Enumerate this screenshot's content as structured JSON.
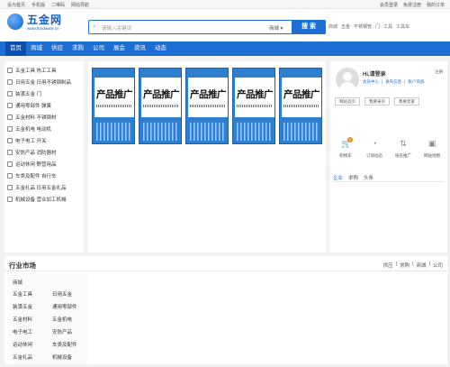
{
  "topbar": {
    "left": [
      "设为首页",
      "手机版",
      "二维码",
      "网站导航"
    ],
    "right": [
      "会员登录",
      "免费注册",
      "我的订单"
    ]
  },
  "logo": {
    "name": "五金网",
    "url": "www.hardware.cn"
  },
  "search": {
    "placeholder": "请输入关键词",
    "scope": "商城",
    "button": "搜 索"
  },
  "hotlinks": [
    "商城",
    "五金",
    "不锈钢管",
    "门",
    "工具",
    "工具车"
  ],
  "nav": [
    "首页",
    "商城",
    "供应",
    "求购",
    "公司",
    "展会",
    "资讯",
    "动态"
  ],
  "categories": [
    "五金工具 热工工具",
    "日用五金 日用不锈钢制品",
    "装潢五金 门",
    "通用零部件 弹簧",
    "五金材料 不锈钢材",
    "五金机电 电动机",
    "电子电工 开关",
    "安防产品 消防器材",
    "运动休闲 野营用品",
    "车类及配件 自行车",
    "五金礼品 日用五金礼品",
    "机械设备 营业加工机械"
  ],
  "promo": {
    "title": "产品推广",
    "count": 5
  },
  "user": {
    "greeting": "Hi,请登录",
    "register": "注册",
    "links": [
      "会员中心",
      "发布信息",
      "账户充值"
    ],
    "buttons": [
      "网站首页",
      "我要采买",
      "我要卖家"
    ],
    "quick": [
      {
        "label": "购物车",
        "icon": "cart-icon",
        "badge": "0"
      },
      {
        "label": "订阅动态",
        "icon": "feed-icon"
      },
      {
        "label": "排名推广",
        "icon": "rank-icon"
      },
      {
        "label": "网站地图",
        "icon": "map-icon"
      }
    ],
    "tabs": [
      "企业",
      "求购",
      "头条"
    ]
  },
  "market": {
    "title": "行业市场",
    "tabs": [
      "供应",
      "|",
      "求购",
      "|",
      "商城",
      "|",
      "公司"
    ],
    "heading": "商城",
    "items": [
      "五金工具",
      "日用五金",
      "装潢五金",
      "通用零部件",
      "五金材料",
      "五金机电",
      "电子电工",
      "安防产品",
      "运动休闲",
      "车类及配件",
      "五金礼品",
      "机械设备"
    ]
  },
  "colors": {
    "brand": "#1d6fd6",
    "nav_active": "#0a4fb0",
    "badge": "#f08c1e"
  }
}
